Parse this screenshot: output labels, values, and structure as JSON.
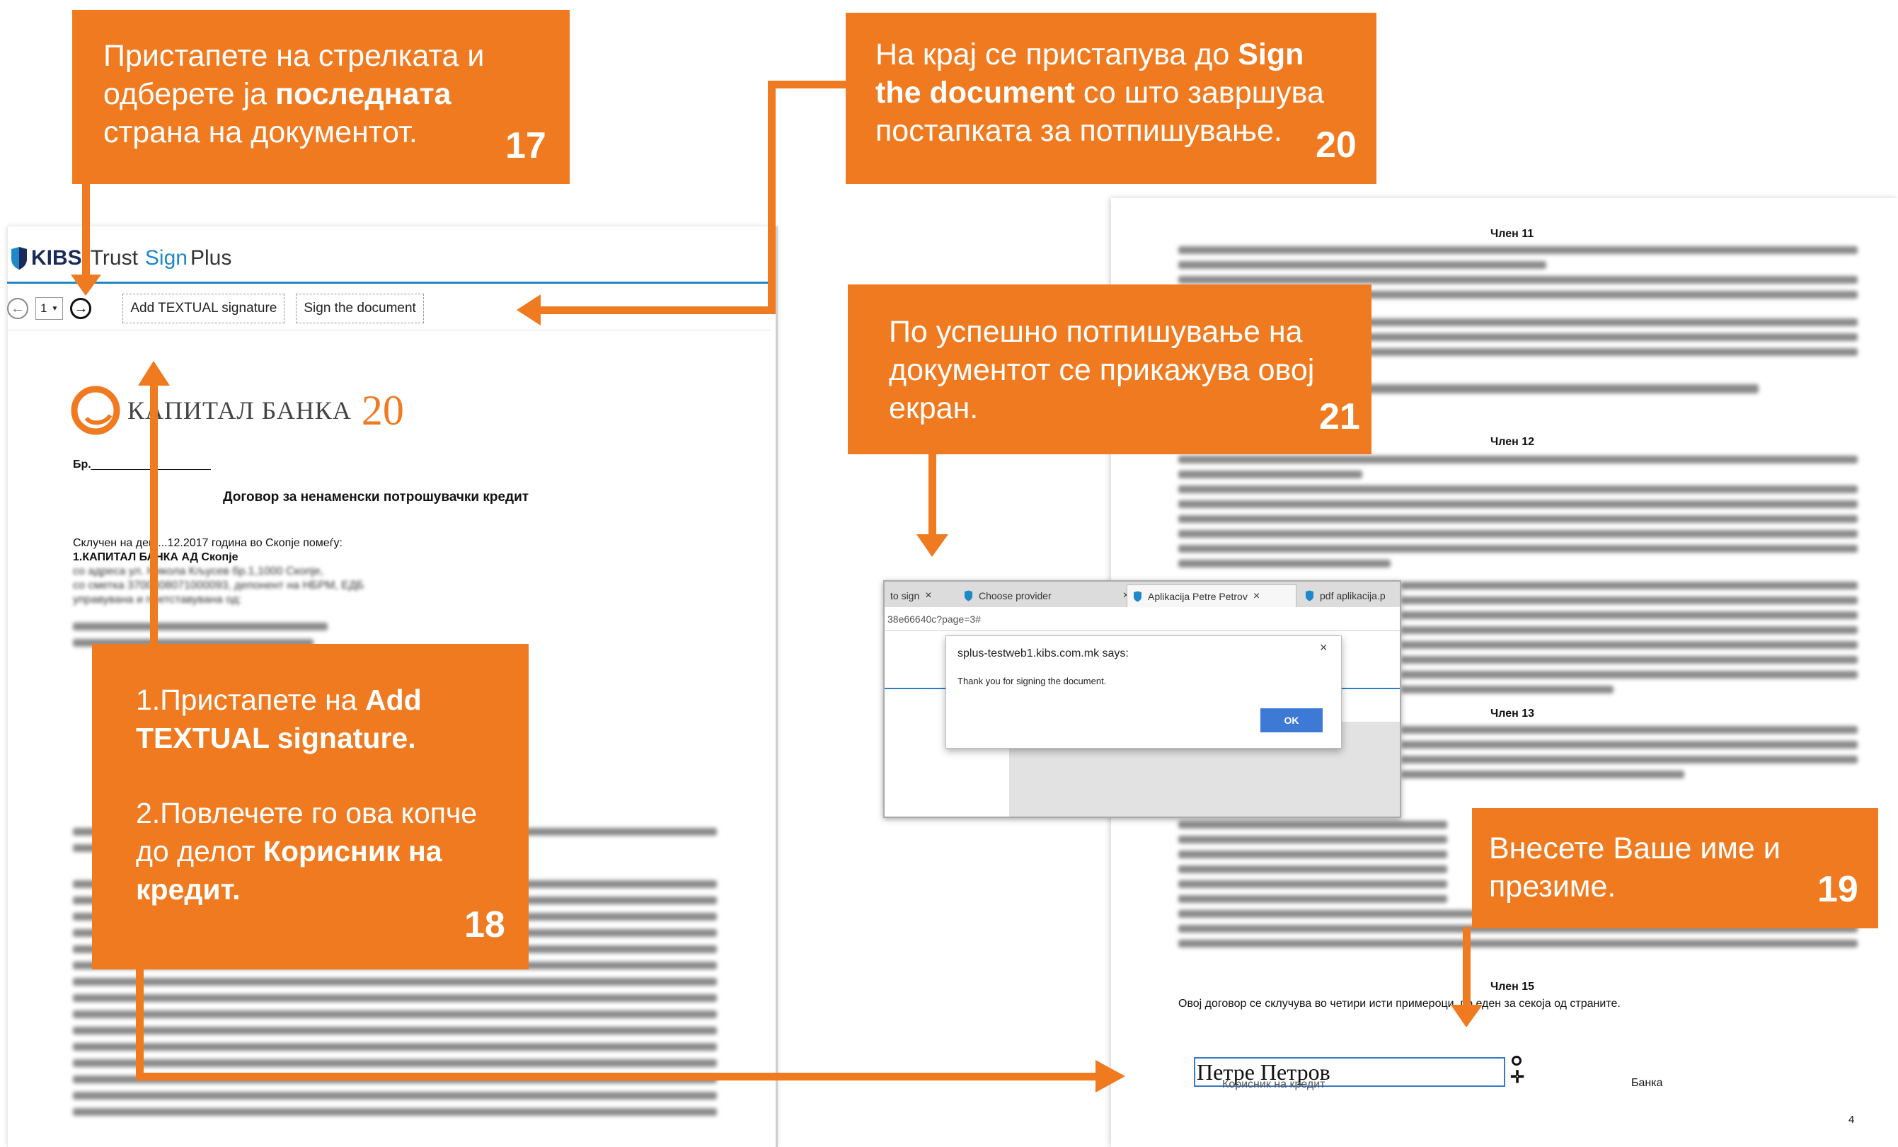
{
  "left_app": {
    "brand": {
      "kibs": "KIBS",
      "trust": "Trust",
      "sign": "Sign",
      "plus": "Plus"
    },
    "toolbar": {
      "back": "←",
      "page_value": "1",
      "next": "→",
      "add_textual_signature": "Add TEXTUAL signature",
      "sign_document": "Sign the document"
    }
  },
  "left_document": {
    "bank_name": "КАПИТАЛ БАНКА",
    "bank_twenty": "20",
    "br_label": "Бр.",
    "title": "Договор за ненаменски потрошувачки кредит",
    "intro_line": "Склучен на ден ...12.2017  година во Скопје помеѓу:",
    "party_name": "1.КАПИТАЛ БАНКА АД Скопје",
    "address_line": "со адреса ул. Никола Кљусев бр.1,1000 Скопје,",
    "account_line": "со сметка 3700308071000093, депонент на НБРМ, ЕДБ",
    "represented_line": "управувана и претставувана од:"
  },
  "right_document": {
    "article_11": "Член 11",
    "article_12": "Член 12",
    "article_13": "Член 13",
    "article_15": "Член 15",
    "final_clause": "Овој договор се склучува во четири исти примероци, по еден за секоја од страните.",
    "signature_value": "Петре Петров",
    "signature_caption": "Корисник на кредит",
    "bank_label": "Банка",
    "page_number": "4"
  },
  "browser_dialog": {
    "tabs": [
      {
        "label": "to sign"
      },
      {
        "label": "Choose provider"
      },
      {
        "label": "Aplikacija Petre Petrov"
      },
      {
        "label": "pdf aplikacija.p"
      }
    ],
    "url_fragment": "38e66640c?page=3#",
    "alert_title": "splus-testweb1.kibs.com.mk says:",
    "alert_message": "Thank you for signing the document.",
    "ok_label": "OK",
    "close_symbol": "×"
  },
  "callouts": {
    "c17": {
      "text_a": "Пристапете на стрелката и одберете ја ",
      "bold": "последната",
      "text_b": " страна на документот.",
      "number": "17"
    },
    "c18": {
      "line1_a": "1.Пристапете на ",
      "line1_bold": "Add TEXTUAL signature.",
      "line2_a": "2.Повлечете го ова копче до делот ",
      "line2_bold": "Корисник на кредит.",
      "number": "18"
    },
    "c19": {
      "text": "Внесете Ваше име и презиме.",
      "number": "19"
    },
    "c20": {
      "text_a": "На крај се пристапува до ",
      "bold": "Sign the document",
      "text_b": " со што завршува постапката за потпишување.",
      "number": "20"
    },
    "c21": {
      "text": "По успешно потпишување на документот се прикажува овој екран.",
      "number": "21"
    }
  },
  "colors": {
    "accent": "#f07a20",
    "brand_blue": "#1e88c9",
    "ok_button": "#3d7ad6"
  }
}
